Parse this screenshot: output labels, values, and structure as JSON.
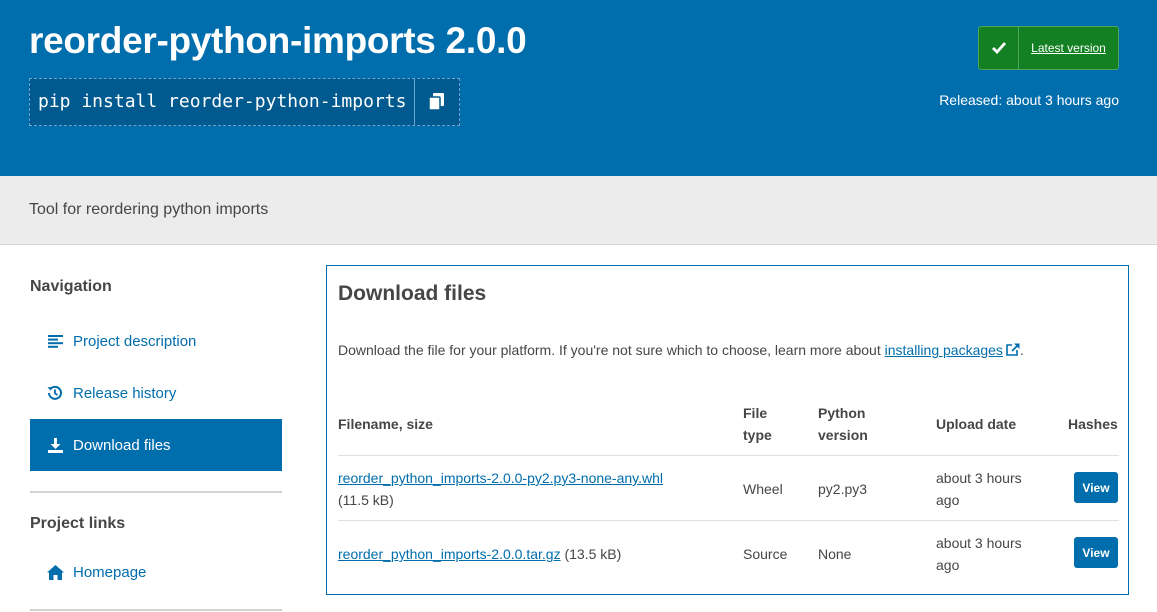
{
  "header": {
    "package_title": "reorder-python-imports 2.0.0",
    "pip_command": "pip install reorder-python-imports",
    "latest_badge_label": "Latest version",
    "released_text": "Released: about 3 hours ago"
  },
  "summary": "Tool for reordering python imports",
  "sidebar": {
    "navigation_heading": "Navigation",
    "nav_items": [
      {
        "label": "Project description",
        "icon": "align-left-icon"
      },
      {
        "label": "Release history",
        "icon": "history-icon"
      },
      {
        "label": "Download files",
        "icon": "download-icon",
        "active": true
      }
    ],
    "project_links_heading": "Project links",
    "links": [
      {
        "label": "Homepage",
        "icon": "home-icon"
      }
    ]
  },
  "download": {
    "title": "Download files",
    "description_prefix": "Download the file for your platform. If you're not sure which to choose, learn more about ",
    "description_link": "installing packages",
    "description_suffix": ".",
    "columns": {
      "filename": "Filename, size",
      "file_type_1": "File",
      "file_type_2": "type",
      "python_version_1": "Python",
      "python_version_2": "version",
      "upload_date": "Upload date",
      "hashes": "Hashes"
    },
    "rows": [
      {
        "filename": "reorder_python_imports-2.0.0-py2.py3-none-any.whl",
        "size": "(11.5 kB)",
        "file_type": "Wheel",
        "python_version": "py2.py3",
        "upload_date_1": "about 3 hours",
        "upload_date_2": "ago",
        "hashes_button": "View"
      },
      {
        "filename": "reorder_python_imports-2.0.0.tar.gz",
        "size": "(13.5 kB)",
        "file_type": "Source",
        "python_version": "None",
        "upload_date_1": "about 3 hours",
        "upload_date_2": "ago",
        "hashes_button": "View"
      }
    ]
  },
  "colors": {
    "brand_blue": "#006dad",
    "latest_green": "#148024"
  }
}
